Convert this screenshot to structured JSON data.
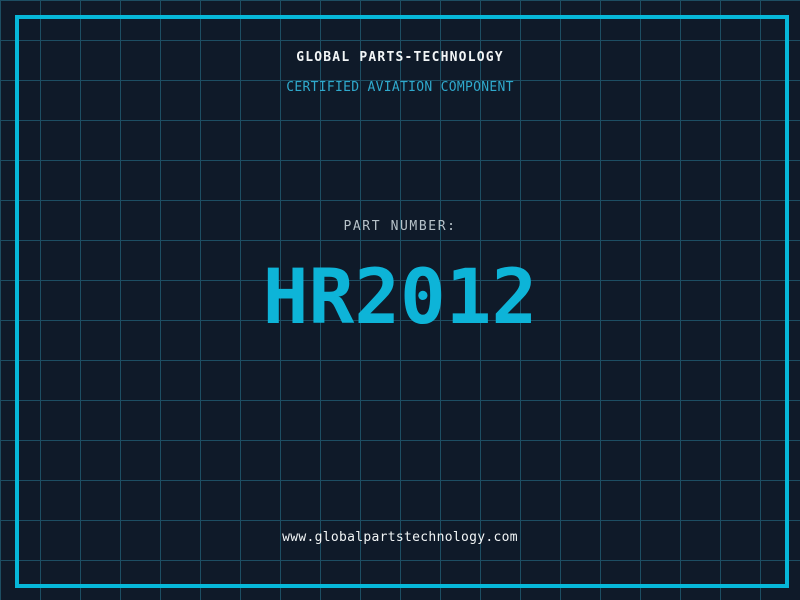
{
  "header": {
    "company_name": "GLOBAL PARTS-TECHNOLOGY",
    "tagline": "CERTIFIED AVIATION COMPONENT"
  },
  "part": {
    "label": "PART NUMBER:",
    "number": "HR2012"
  },
  "footer": {
    "website": "www.globalpartstechnology.com"
  },
  "colors": {
    "background": "#0f1a29",
    "grid_line": "#1d4e63",
    "frame": "#06b7d9",
    "part_number": "#0db4d8",
    "tagline": "#2fa9cc",
    "part_label": "#b7c2c9",
    "heading_text": "#f2f5f6"
  }
}
